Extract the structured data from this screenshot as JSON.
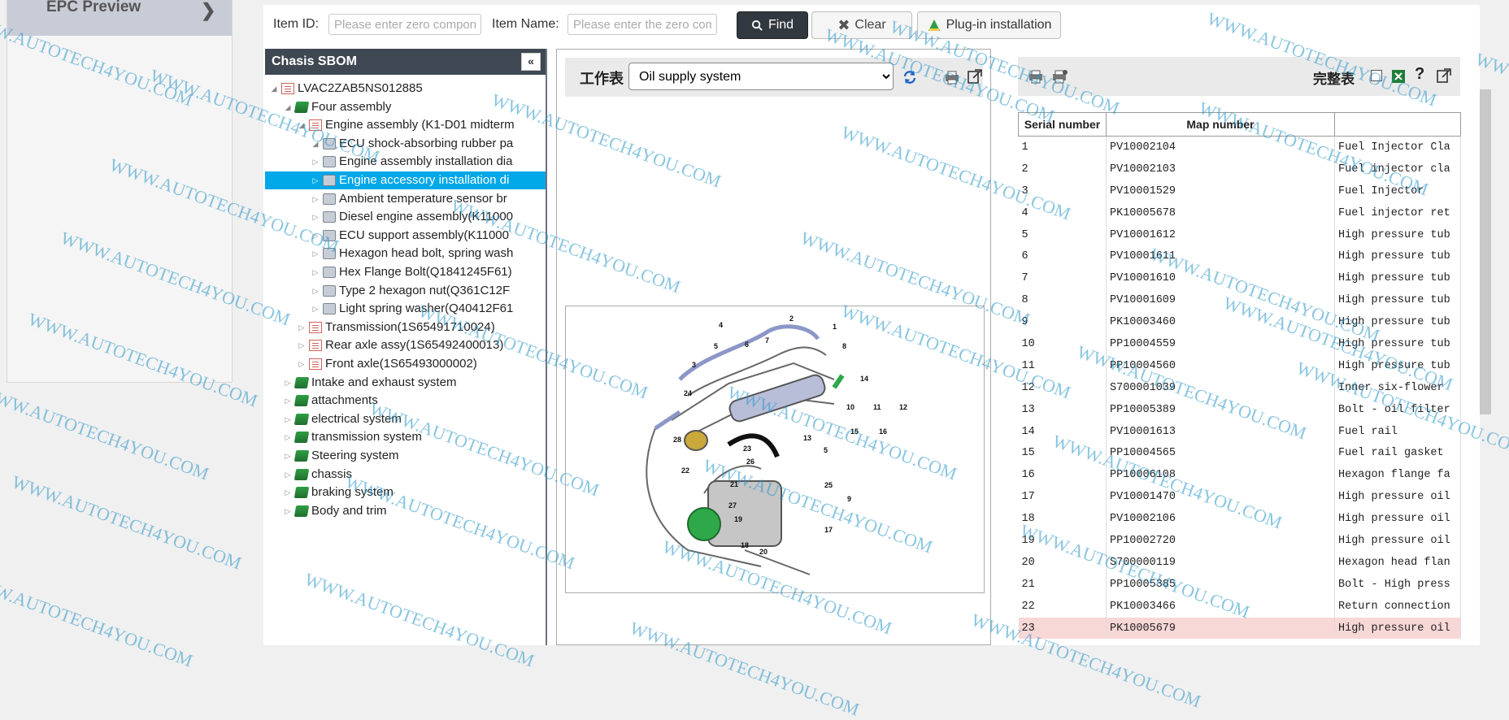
{
  "sidebar": {
    "epc_preview_label": "EPC Preview"
  },
  "toolbar": {
    "item_id_label": "Item ID:",
    "item_id_placeholder": "Please enter zero compon",
    "item_name_label": "Item Name:",
    "item_name_placeholder": "Please enter the zero com",
    "find_label": "Find",
    "clear_label": "Clear",
    "plugin_label": "Plug-in installation"
  },
  "tree": {
    "header": "Chasis SBOM",
    "rows": [
      {
        "label": "LVAC2ZAB5NS012885",
        "level": 0,
        "icon": "vehicle-icon",
        "expanded": true
      },
      {
        "label": "Four assembly",
        "level": 1,
        "icon": "assembly-icon",
        "expanded": true
      },
      {
        "label": "Engine assembly (K1-D01 midterm",
        "level": 2,
        "icon": "document-icon",
        "expanded": true
      },
      {
        "label": "ECU shock-absorbing rubber pa",
        "level": 3,
        "icon": "part-icon",
        "expanded": true
      },
      {
        "label": "Engine assembly installation dia",
        "level": 3,
        "icon": "part-icon",
        "expanded": false
      },
      {
        "label": "Engine accessory installation di",
        "level": 3,
        "icon": "part-icon",
        "expanded": false,
        "selected": true
      },
      {
        "label": "Ambient temperature sensor br",
        "level": 3,
        "icon": "part-icon",
        "expanded": false
      },
      {
        "label": "Diesel engine assembly(K11000",
        "level": 3,
        "icon": "part-icon",
        "expanded": false
      },
      {
        "label": "ECU support assembly(K11000",
        "level": 3,
        "icon": "part-icon",
        "expanded": false
      },
      {
        "label": "Hexagon head bolt, spring wash",
        "level": 3,
        "icon": "part-icon",
        "expanded": false
      },
      {
        "label": "Hex Flange Bolt(Q1841245F61)",
        "level": 3,
        "icon": "part-icon",
        "expanded": false
      },
      {
        "label": "Type 2 hexagon nut(Q361C12F",
        "level": 3,
        "icon": "part-icon",
        "expanded": false
      },
      {
        "label": "Light spring washer(Q40412F61",
        "level": 3,
        "icon": "part-icon",
        "expanded": false
      },
      {
        "label": "Transmission(1S65491710024)",
        "level": 2,
        "icon": "document-icon",
        "expanded": false
      },
      {
        "label": "Rear axle assy(1S65492400013)",
        "level": 2,
        "icon": "document-icon",
        "expanded": false
      },
      {
        "label": "Front axle(1S65493000002)",
        "level": 2,
        "icon": "document-icon",
        "expanded": false
      },
      {
        "label": "Intake and exhaust system",
        "level": 1,
        "icon": "assembly-icon",
        "expanded": false
      },
      {
        "label": "attachments",
        "level": 1,
        "icon": "assembly-icon",
        "expanded": false
      },
      {
        "label": "electrical system",
        "level": 1,
        "icon": "assembly-icon",
        "expanded": false
      },
      {
        "label": "transmission system",
        "level": 1,
        "icon": "assembly-icon",
        "expanded": false
      },
      {
        "label": "Steering system",
        "level": 1,
        "icon": "assembly-icon",
        "expanded": false
      },
      {
        "label": "chassis",
        "level": 1,
        "icon": "assembly-icon",
        "expanded": false
      },
      {
        "label": "braking system",
        "level": 1,
        "icon": "assembly-icon",
        "expanded": false
      },
      {
        "label": "Body and trim",
        "level": 1,
        "icon": "assembly-icon",
        "expanded": false
      }
    ]
  },
  "middle": {
    "title": "工作表",
    "selected_system": "Oil supply system",
    "diagram_labels": [
      "1",
      "2",
      "3",
      "4",
      "5",
      "6",
      "7",
      "8",
      "10",
      "11",
      "12",
      "13",
      "14",
      "15",
      "16",
      "17",
      "18",
      "19",
      "20",
      "21",
      "22",
      "23",
      "24",
      "25",
      "26",
      "27",
      "28",
      "5",
      "9"
    ]
  },
  "right": {
    "full_table_label": "完整表",
    "columns": [
      "Serial number",
      "Map number",
      ""
    ],
    "rows": [
      {
        "serial": "1",
        "map": "PV10002104",
        "name": "Fuel Injector Cla"
      },
      {
        "serial": "2",
        "map": "PV10002103",
        "name": "Fuel injector cla"
      },
      {
        "serial": "3",
        "map": "PV10001529",
        "name": "Fuel Injector"
      },
      {
        "serial": "4",
        "map": "PK10005678",
        "name": "Fuel injector ret"
      },
      {
        "serial": "5",
        "map": "PV10001612",
        "name": "High pressure tub"
      },
      {
        "serial": "6",
        "map": "PV10001611",
        "name": "High pressure tub"
      },
      {
        "serial": "7",
        "map": "PV10001610",
        "name": "High pressure tub"
      },
      {
        "serial": "8",
        "map": "PV10001609",
        "name": "High pressure tub"
      },
      {
        "serial": "9",
        "map": "PK10003460",
        "name": "High pressure tub"
      },
      {
        "serial": "10",
        "map": "PP10004559",
        "name": "High pressure tub"
      },
      {
        "serial": "11",
        "map": "PP10004560",
        "name": "High pressure tub"
      },
      {
        "serial": "12",
        "map": "S700001039",
        "name": "Inner six-flower"
      },
      {
        "serial": "13",
        "map": "PP10005389",
        "name": "Bolt - oil filter"
      },
      {
        "serial": "14",
        "map": "PV10001613",
        "name": "Fuel rail"
      },
      {
        "serial": "15",
        "map": "PP10004565",
        "name": "Fuel rail gasket"
      },
      {
        "serial": "16",
        "map": "PP10006108",
        "name": "Hexagon flange fa"
      },
      {
        "serial": "17",
        "map": "PV10001470",
        "name": "High pressure oil"
      },
      {
        "serial": "18",
        "map": "PV10002106",
        "name": "High pressure oil"
      },
      {
        "serial": "19",
        "map": "PP10002720",
        "name": "High pressure oil"
      },
      {
        "serial": "20",
        "map": "S700000119",
        "name": "Hexagon head flan"
      },
      {
        "serial": "21",
        "map": "PP10005385",
        "name": "Bolt - High press"
      },
      {
        "serial": "22",
        "map": "PK10003466",
        "name": "Return connection"
      },
      {
        "serial": "23",
        "map": "PK10005679",
        "name": "High pressure oil",
        "highlight": true
      }
    ]
  },
  "watermark_text": "WWW.AUTOTECH4YOU.COM",
  "colors": {
    "selected_row": "#00a8e8",
    "header_dark": "#3f4852",
    "highlight_row": "#f8d7d7",
    "find_button": "#32383f"
  }
}
